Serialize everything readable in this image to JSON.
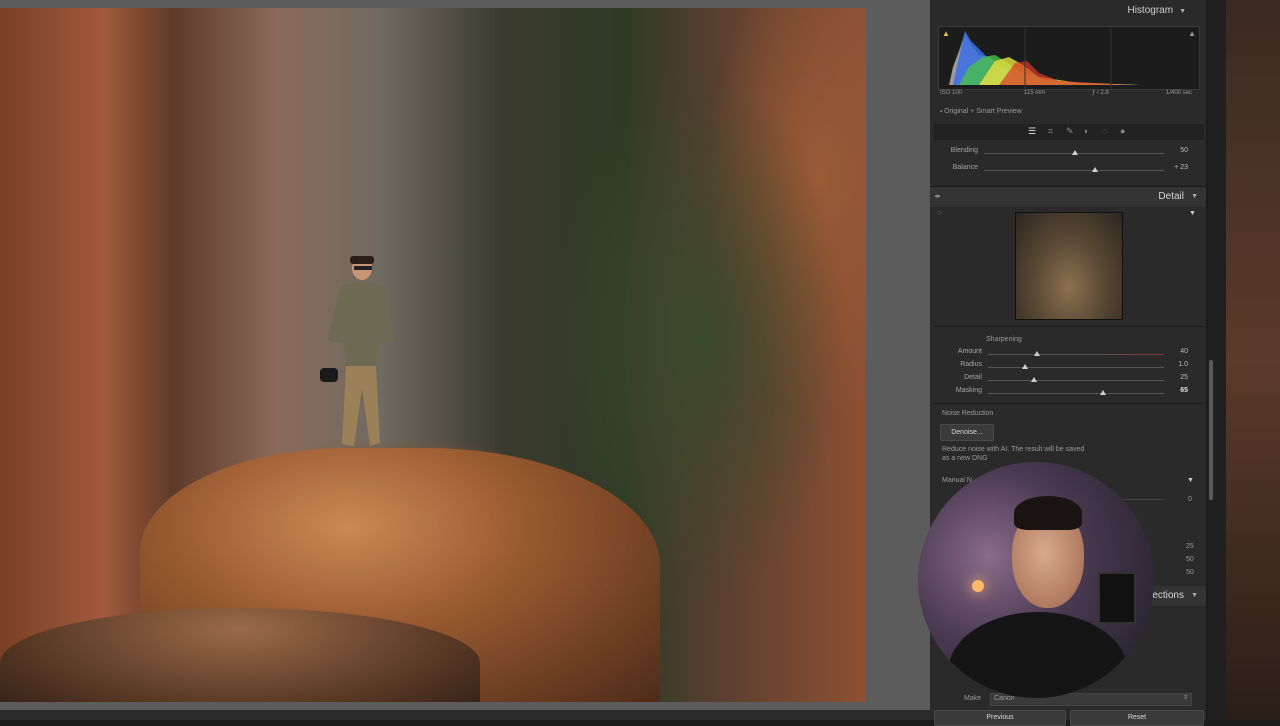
{
  "panel": {
    "histogram_title": "Histogram",
    "exif": {
      "iso": "ISO 100",
      "focal": "115 mm",
      "aperture": "ƒ / 2.8",
      "shutter": "1/400 sec"
    },
    "preview_label": "Original + Smart Preview",
    "split_toning": {
      "sliders": [
        {
          "label": "Blending",
          "value": "50",
          "level": 0.5
        },
        {
          "label": "Balance",
          "value": "+ 23",
          "level": 0.62
        }
      ]
    },
    "detail": {
      "title": "Detail",
      "sharpening_label": "Sharpening",
      "sliders": [
        {
          "label": "Amount",
          "value": "40",
          "level": 0.27
        },
        {
          "label": "Radius",
          "value": "1.0",
          "level": 0.17
        },
        {
          "label": "Detail",
          "value": "25",
          "level": 0.25
        },
        {
          "label": "Masking",
          "value": "65",
          "level": 0.65
        }
      ],
      "noise_reduction_label": "Noise Reduction",
      "denoise_button": "Denoise...",
      "denoise_note_1": "Reduce noise with AI. The result will be saved",
      "denoise_note_2": "as a new DNG",
      "manual_label": "Manual N",
      "manual_values": [
        "0",
        "25",
        "50",
        "50"
      ]
    },
    "lens_corrections_label": "rrections",
    "make_label": "Make",
    "make_value": "Canon",
    "bottom_buttons": [
      "Previous",
      "Reset"
    ]
  },
  "colors": {
    "panel_bg": "#2a2a2a",
    "accent_red": "#c0392b",
    "histogram_blue": "#3a6ee8",
    "histogram_yellow": "#e8e040",
    "histogram_green": "#46c04a"
  },
  "icons": [
    "warning-triangle-icon",
    "shadow-clip-icon",
    "edit-icon",
    "crop-icon",
    "heal-icon",
    "mask-icon",
    "redeye-icon",
    "preset-icon",
    "disclosure-triangle-icon",
    "switch-icon"
  ]
}
